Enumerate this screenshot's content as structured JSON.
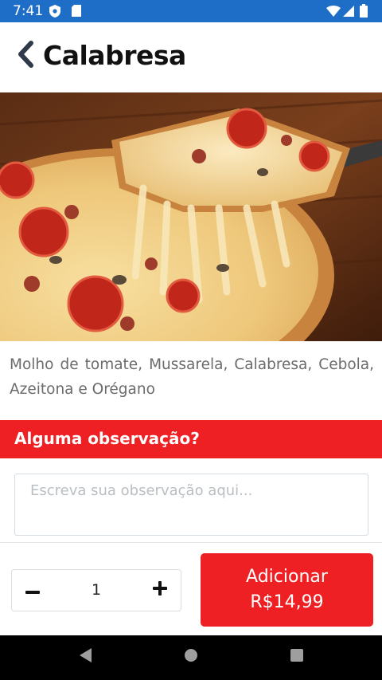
{
  "status_bar": {
    "time": "7:41",
    "left_icons": [
      "shield-notification-icon",
      "sd-card-icon"
    ],
    "right_icons": [
      "wifi-icon",
      "cell-signal-icon",
      "battery-icon"
    ],
    "background": "#1e6ec8"
  },
  "header": {
    "title": "Calabresa",
    "back_icon": "chevron-left-icon"
  },
  "product": {
    "image_subject": "pizza-slice-photo",
    "description": "Molho de tomate, Mussarela, Calabresa, Cebola, Azeitona e Orégano"
  },
  "notes_section": {
    "title": "Alguma observação?",
    "placeholder": "Escreva sua observação aqui...",
    "value": ""
  },
  "quantity": {
    "minus_icon": "minus-icon",
    "value": "1",
    "plus_icon": "plus-icon"
  },
  "add_button": {
    "label": "Adicionar",
    "price": "R$14,99"
  },
  "nav_bar": {
    "icons": [
      "back-triangle-icon",
      "home-circle-icon",
      "recents-square-icon"
    ]
  },
  "colors": {
    "accent": "#ee2024",
    "status_bar": "#1e6ec8",
    "text_primary": "#111111",
    "text_secondary": "#6b6b6b"
  }
}
